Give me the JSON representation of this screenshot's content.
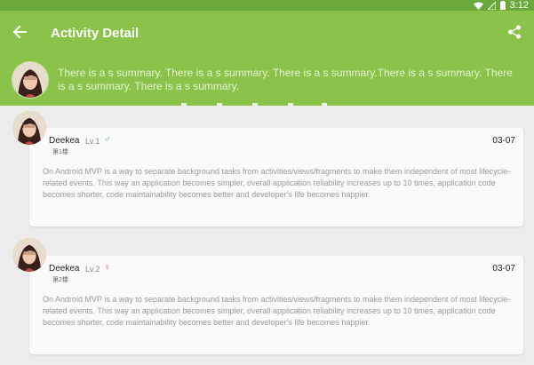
{
  "status_bar": {
    "time": "3:12",
    "icons": [
      "wifi-icon",
      "signal-icon",
      "battery-icon"
    ],
    "color": "#6aa83b"
  },
  "toolbar": {
    "title": "Activity Detail",
    "back_icon": "arrow-back-icon",
    "share_icon": "share-icon",
    "color": "#8bc34a"
  },
  "header": {
    "summary": "There is a s summary. There is a s summary. There is a s summary.There is a s summary. There is a s summary. There is a s summary."
  },
  "comments": [
    {
      "name": "Deekea",
      "level": "Lv.1",
      "gender": "♂",
      "gender_color": "#4f9be0",
      "floor": "第1楼",
      "date": "03-07",
      "content": "On Android MVP is a way to separate background tasks from activities/views/fragments to make them independent of most lifecycle-related events. This way an application becomes simpler, overall application reliability increases up to 10 times, application code becomes shorter, code maintainability becomes better and developer's life becomes happier."
    },
    {
      "name": "Deekea",
      "level": "Lv.2",
      "gender": "♀",
      "gender_color": "#e74a7b",
      "floor": "第2楼",
      "date": "03-07",
      "content": "On Android MVP is a way to separate background tasks from activities/views/fragments to make them independent of most lifecycle-related events. This way an application becomes simpler, overall application reliability increases up to 10 times, application code becomes shorter, code maintainability becomes better and developer's life becomes happier."
    }
  ]
}
